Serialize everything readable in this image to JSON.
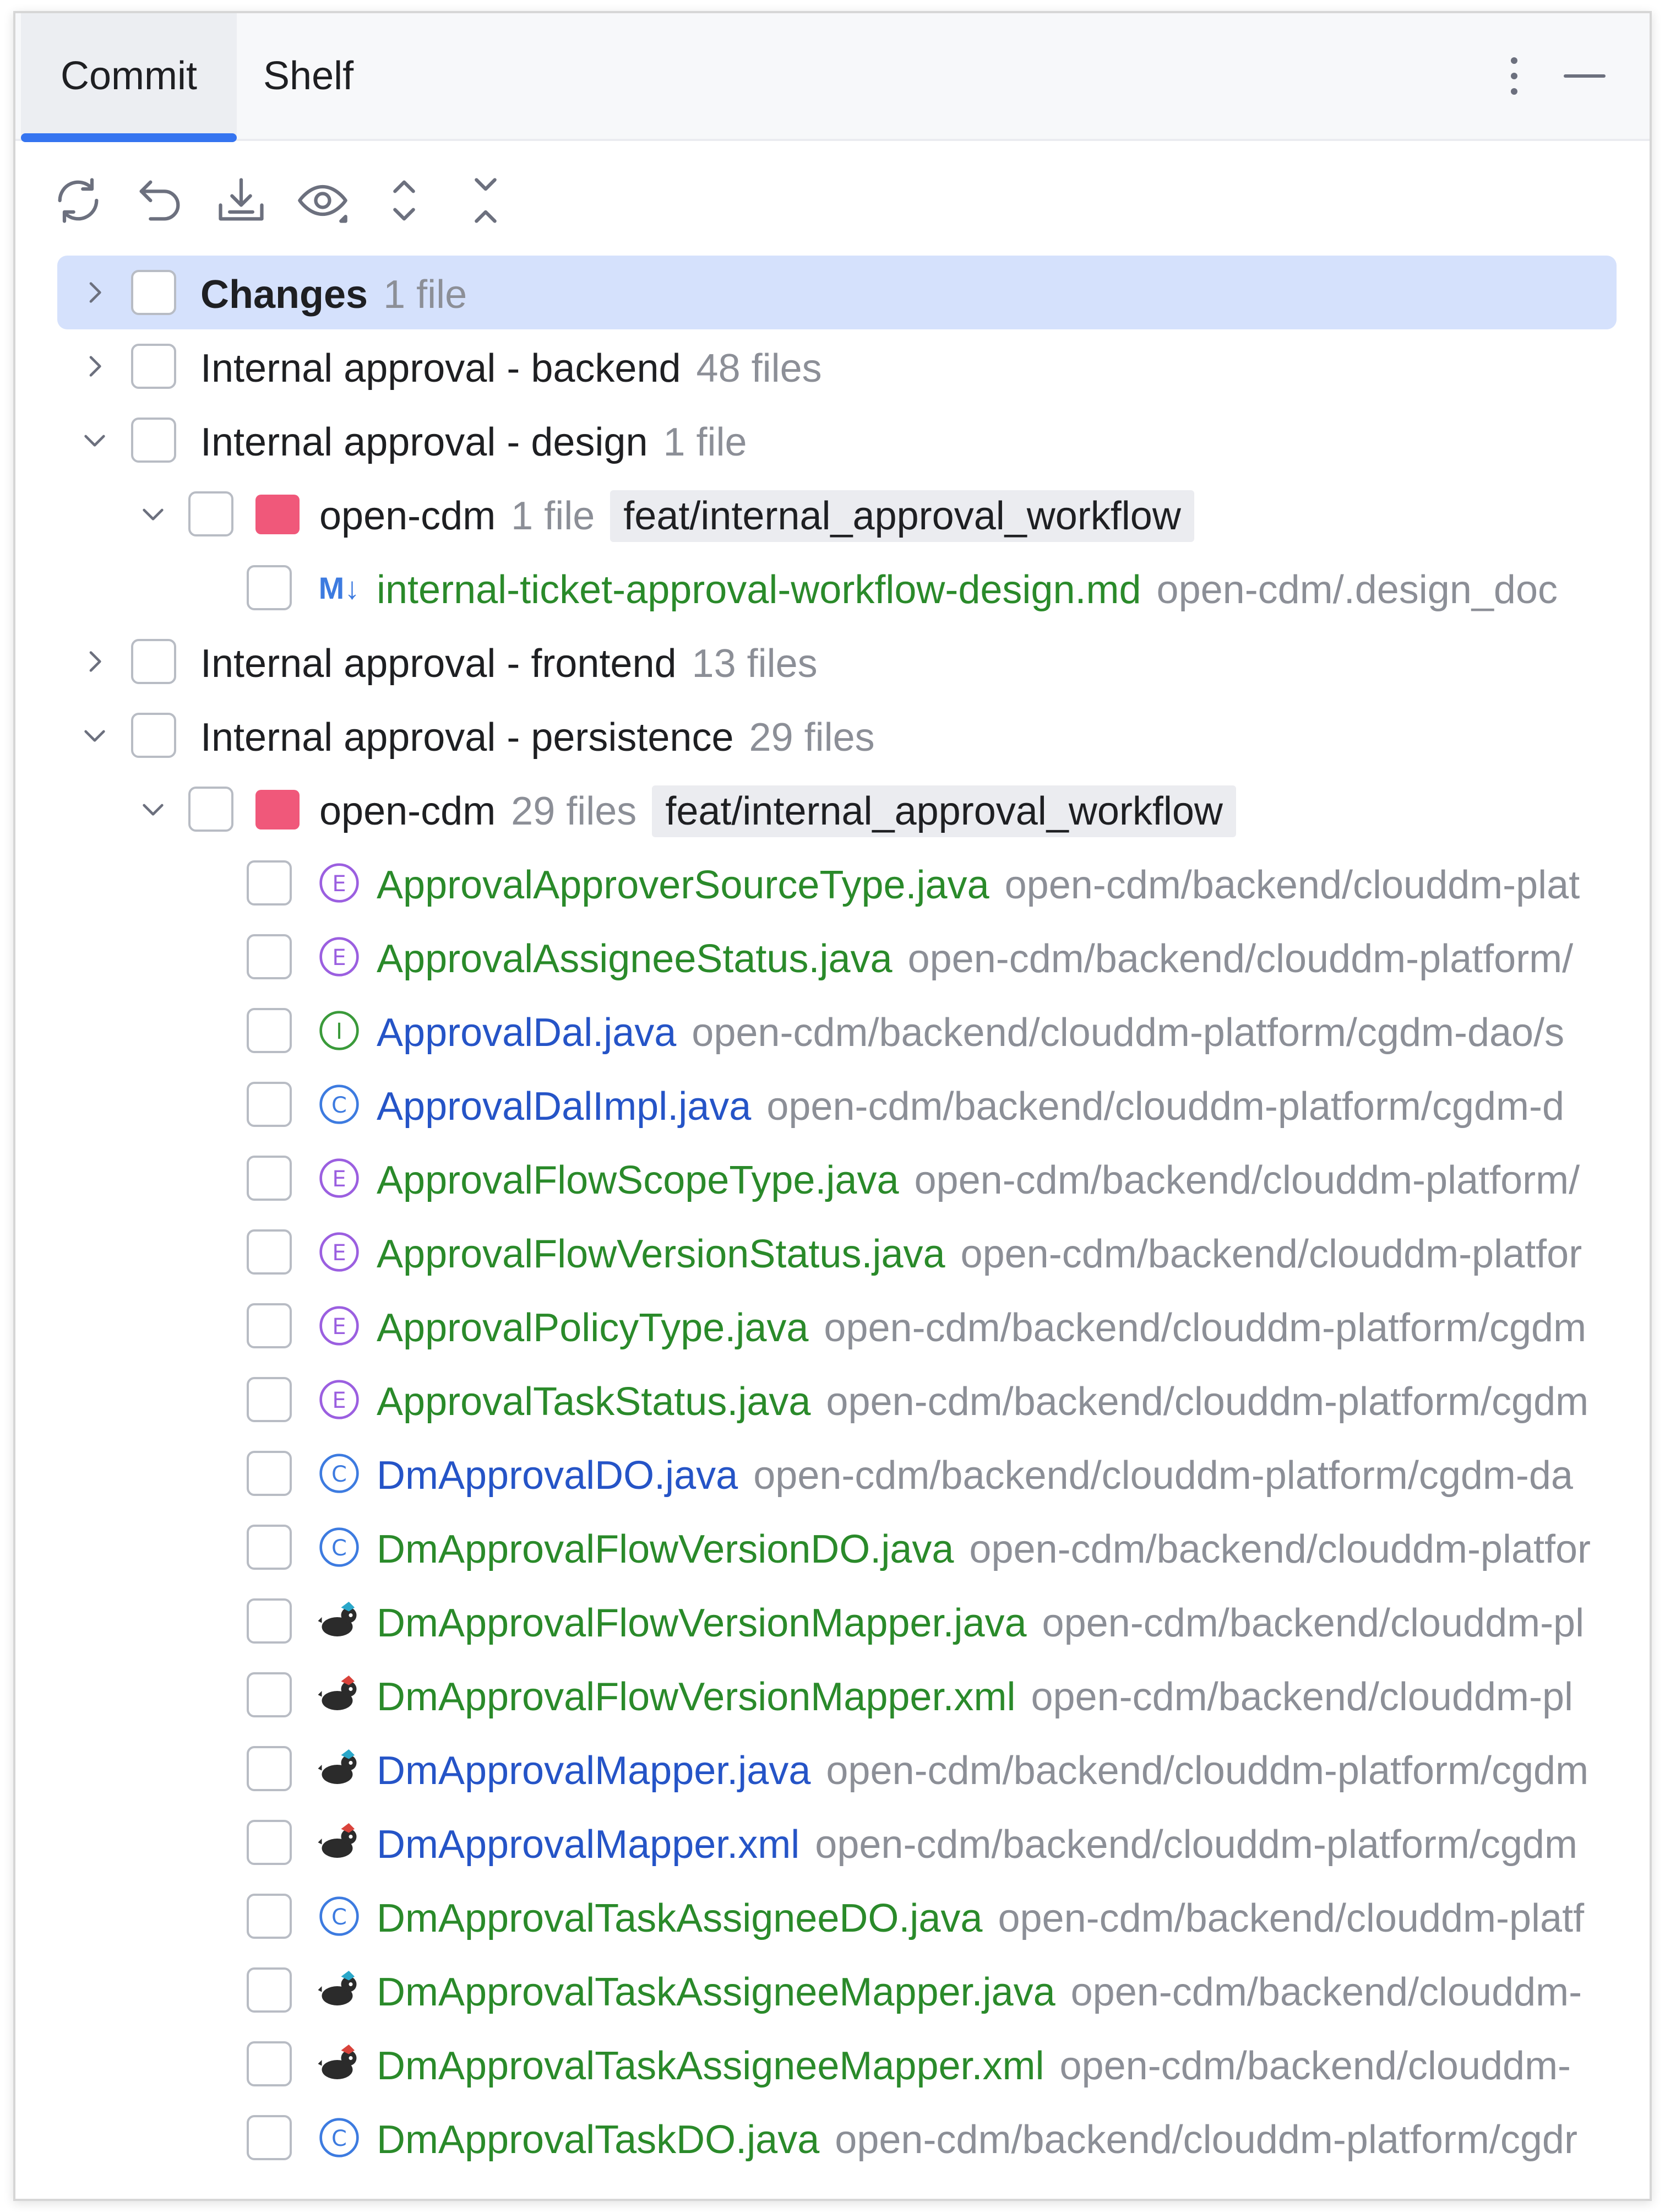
{
  "tabs": [
    {
      "label": "Commit",
      "active": true
    },
    {
      "label": "Shelf",
      "active": false
    }
  ],
  "toolbar": {
    "icons": [
      "refresh-icon",
      "rollback-icon",
      "shelve-icon",
      "view-options-icon",
      "expand-all-icon",
      "collapse-all-icon"
    ]
  },
  "colors": {
    "accent": "#3574f0",
    "selected_row": "#d5e1fc",
    "added_file": "#2a8a2a",
    "modified_file": "#2554c7",
    "repo_color": "#f0587a",
    "enum_icon": "#9b5fe0",
    "interface_icon": "#3a9a3a",
    "class_icon": "#3d7be0"
  },
  "tree": {
    "groups": [
      {
        "name": "Changes",
        "count": "1 file",
        "expanded": false,
        "selected": true,
        "bold": true
      },
      {
        "name": "Internal approval - backend",
        "count": "48 files",
        "expanded": false
      },
      {
        "name": "Internal approval - design",
        "count": "1 file",
        "expanded": true,
        "repo": {
          "name": "open-cdm",
          "count": "1 file",
          "branch": "feat/internal_approval_workflow"
        },
        "files": [
          {
            "icon": "markdown-icon",
            "icon_text": "M↓",
            "name": "internal-ticket-approval-workflow-design.md",
            "status": "added",
            "path": "open-cdm/.design_doc"
          }
        ]
      },
      {
        "name": "Internal approval - frontend",
        "count": "13 files",
        "expanded": false
      },
      {
        "name": "Internal approval - persistence",
        "count": "29 files",
        "expanded": true,
        "repo": {
          "name": "open-cdm",
          "count": "29 files",
          "branch": "feat/internal_approval_workflow"
        },
        "files": [
          {
            "icon": "enum-icon",
            "icon_text": "E",
            "name": "ApprovalApproverSourceType.java",
            "status": "added",
            "path": "open-cdm/backend/clouddm-plat"
          },
          {
            "icon": "enum-icon",
            "icon_text": "E",
            "name": "ApprovalAssigneeStatus.java",
            "status": "added",
            "path": "open-cdm/backend/clouddm-platform/"
          },
          {
            "icon": "interface-icon",
            "icon_text": "I",
            "name": "ApprovalDal.java",
            "status": "modified",
            "path": "open-cdm/backend/clouddm-platform/cgdm-dao/s"
          },
          {
            "icon": "class-icon",
            "icon_text": "C",
            "name": "ApprovalDalImpl.java",
            "status": "modified",
            "path": "open-cdm/backend/clouddm-platform/cgdm-d"
          },
          {
            "icon": "enum-icon",
            "icon_text": "E",
            "name": "ApprovalFlowScopeType.java",
            "status": "added",
            "path": "open-cdm/backend/clouddm-platform/"
          },
          {
            "icon": "enum-icon",
            "icon_text": "E",
            "name": "ApprovalFlowVersionStatus.java",
            "status": "added",
            "path": "open-cdm/backend/clouddm-platfor"
          },
          {
            "icon": "enum-icon",
            "icon_text": "E",
            "name": "ApprovalPolicyType.java",
            "status": "added",
            "path": "open-cdm/backend/clouddm-platform/cgdm"
          },
          {
            "icon": "enum-icon",
            "icon_text": "E",
            "name": "ApprovalTaskStatus.java",
            "status": "added",
            "path": "open-cdm/backend/clouddm-platform/cgdm"
          },
          {
            "icon": "class-icon",
            "icon_text": "C",
            "name": "DmApprovalDO.java",
            "status": "modified",
            "path": "open-cdm/backend/clouddm-platform/cgdm-da"
          },
          {
            "icon": "class-icon",
            "icon_text": "C",
            "name": "DmApprovalFlowVersionDO.java",
            "status": "added",
            "path": "open-cdm/backend/clouddm-platfor"
          },
          {
            "icon": "mybatis-java-icon",
            "icon_text": "",
            "name": "DmApprovalFlowVersionMapper.java",
            "status": "added",
            "path": "open-cdm/backend/clouddm-pl"
          },
          {
            "icon": "mybatis-xml-icon",
            "icon_text": "",
            "name": "DmApprovalFlowVersionMapper.xml",
            "status": "added",
            "path": "open-cdm/backend/clouddm-pl"
          },
          {
            "icon": "mybatis-java-icon",
            "icon_text": "",
            "name": "DmApprovalMapper.java",
            "status": "modified",
            "path": "open-cdm/backend/clouddm-platform/cgdm"
          },
          {
            "icon": "mybatis-xml-icon",
            "icon_text": "",
            "name": "DmApprovalMapper.xml",
            "status": "modified",
            "path": "open-cdm/backend/clouddm-platform/cgdm"
          },
          {
            "icon": "class-icon",
            "icon_text": "C",
            "name": "DmApprovalTaskAssigneeDO.java",
            "status": "added",
            "path": "open-cdm/backend/clouddm-platf"
          },
          {
            "icon": "mybatis-java-icon",
            "icon_text": "",
            "name": "DmApprovalTaskAssigneeMapper.java",
            "status": "added",
            "path": "open-cdm/backend/clouddm-"
          },
          {
            "icon": "mybatis-xml-icon",
            "icon_text": "",
            "name": "DmApprovalTaskAssigneeMapper.xml",
            "status": "added",
            "path": "open-cdm/backend/clouddm-"
          },
          {
            "icon": "class-icon",
            "icon_text": "C",
            "name": "DmApprovalTaskDO.java",
            "status": "added",
            "path": "open-cdm/backend/clouddm-platform/cgdr"
          }
        ]
      }
    ]
  }
}
